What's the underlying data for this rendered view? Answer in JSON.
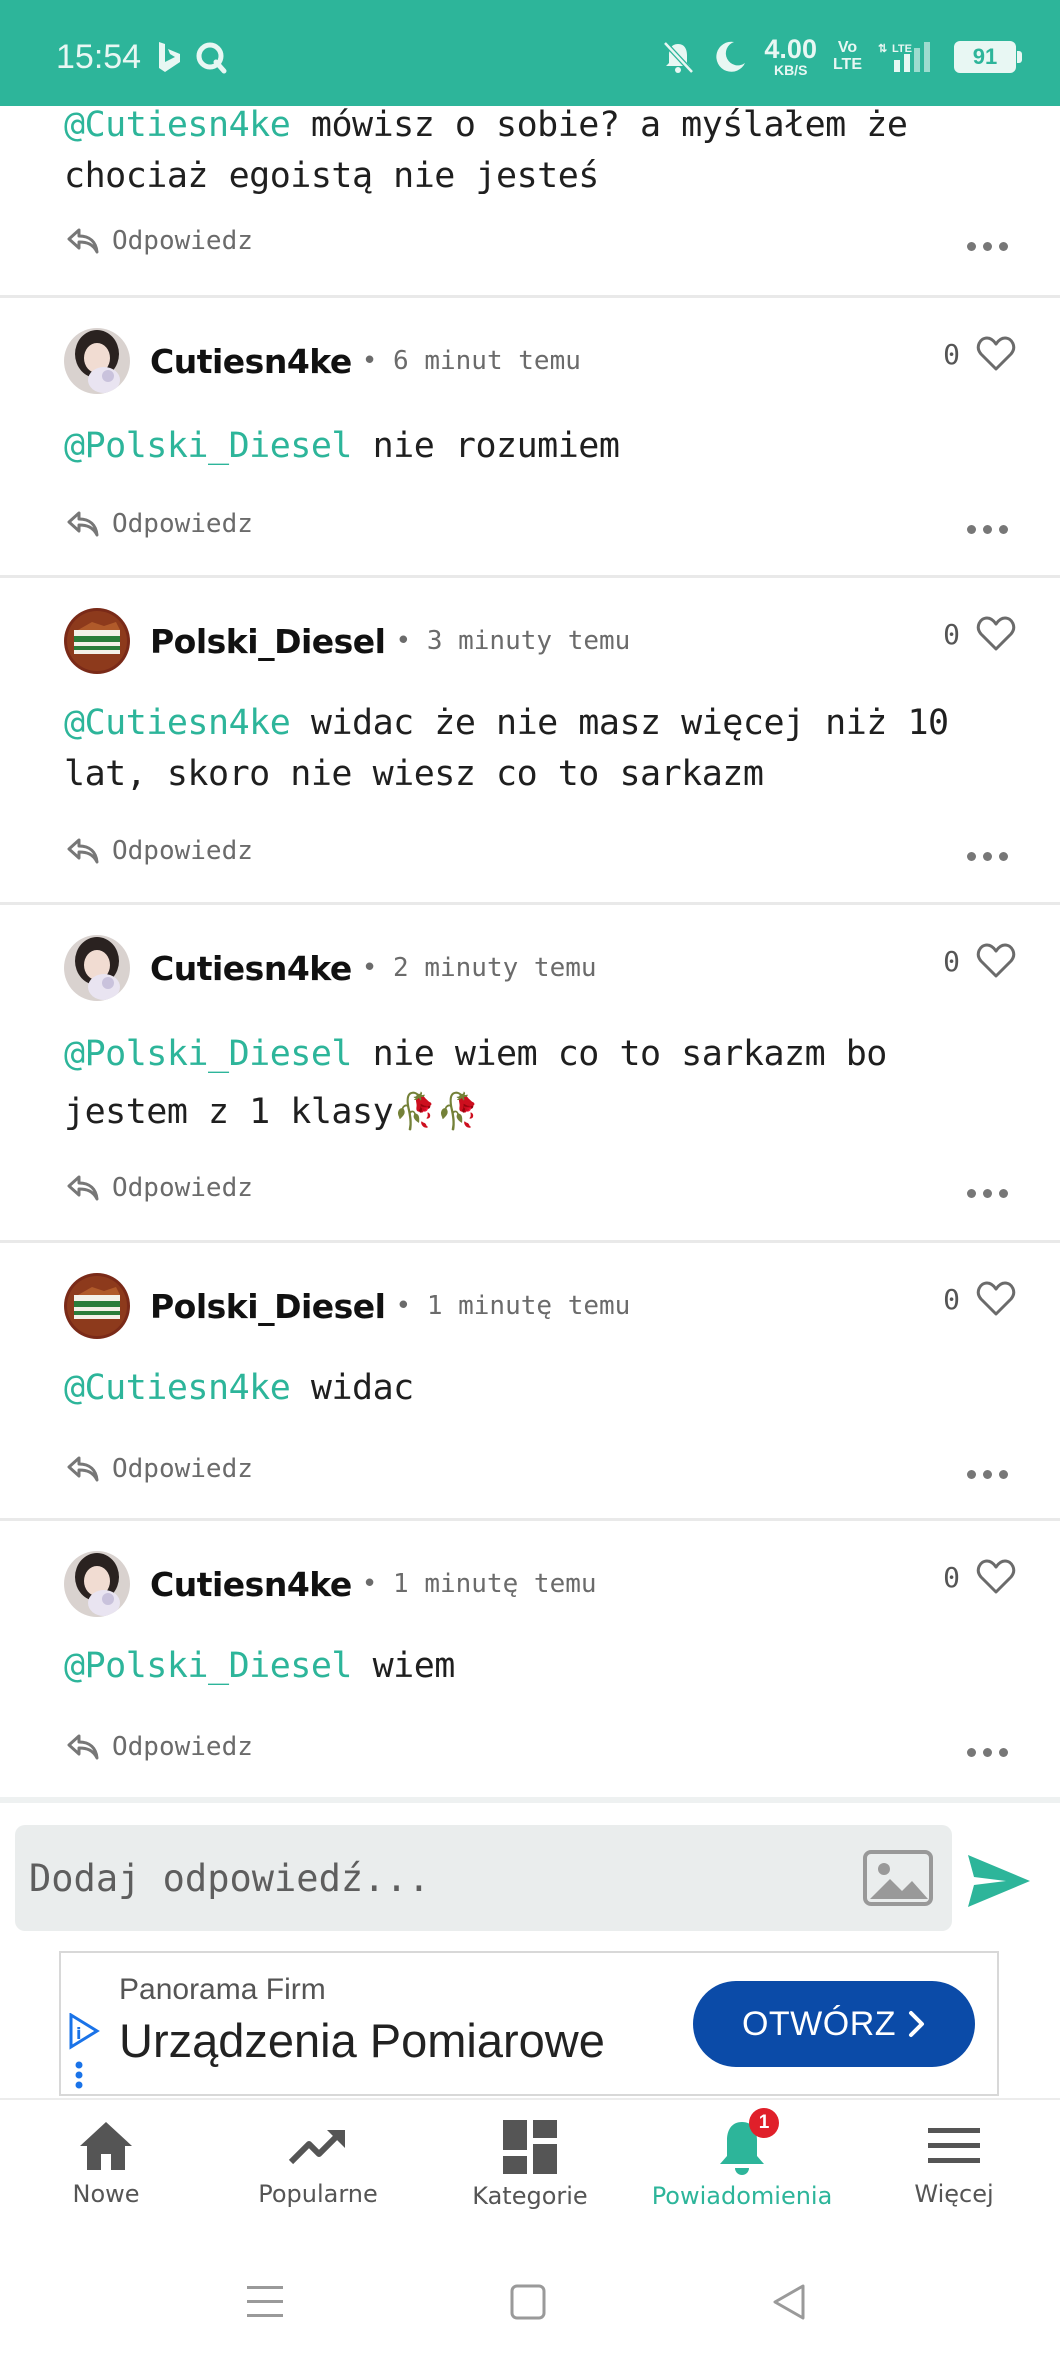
{
  "status_bar": {
    "time": "15:54",
    "net_speed": "4.00",
    "net_unit": "KB/S",
    "volte_top": "Vo",
    "volte_bottom": "LTE",
    "lte": "LTE",
    "battery": "91",
    "color": "#2db59a"
  },
  "comments": [
    {
      "mention": "@Cutiesn4ke",
      "text": " mówisz o sobie? a myślałem że chociaż egoistą nie jesteś",
      "reply_label": "Odpowiedz",
      "partial": true
    },
    {
      "username": "Cutiesn4ke",
      "time": "6 minut temu",
      "likes": "0",
      "avatar": "girl-avatar",
      "mention": "@Polski_Diesel",
      "text": " nie rozumiem",
      "reply_label": "Odpowiedz"
    },
    {
      "username": "Polski_Diesel",
      "time": "3 minuty temu",
      "likes": "0",
      "avatar": "flag-avatar",
      "mention": "@Cutiesn4ke",
      "text": " widac że nie masz więcej niż 10 lat, skoro nie wiesz co to sarkazm",
      "reply_label": "Odpowiedz"
    },
    {
      "username": "Cutiesn4ke",
      "time": "2 minuty temu",
      "likes": "0",
      "avatar": "girl-avatar",
      "mention": "@Polski_Diesel",
      "text": " nie wiem co to sarkazm bo jestem z 1 klasy🥀🥀",
      "reply_label": "Odpowiedz"
    },
    {
      "username": "Polski_Diesel",
      "time": "1 minutę temu",
      "likes": "0",
      "avatar": "flag-avatar",
      "mention": "@Cutiesn4ke",
      "text": " widac",
      "reply_label": "Odpowiedz"
    },
    {
      "username": "Cutiesn4ke",
      "time": "1 minutę temu",
      "likes": "0",
      "avatar": "girl-avatar",
      "mention": "@Polski_Diesel",
      "text": " wiem",
      "reply_label": "Odpowiedz"
    }
  ],
  "reply_bar": {
    "placeholder": "Dodaj odpowiedź..."
  },
  "ad": {
    "brand": "Panorama Firm",
    "title": "Urządzenia Pomiarowe",
    "cta": "OTWÓRZ",
    "cta_color": "#0b4ba8"
  },
  "bottom_nav": {
    "items": [
      {
        "label": "Nowe",
        "icon": "home-icon"
      },
      {
        "label": "Popularne",
        "icon": "trending-icon"
      },
      {
        "label": "Kategorie",
        "icon": "grid-icon"
      },
      {
        "label": "Powiadomienia",
        "icon": "bell-icon",
        "active": true,
        "badge": "1"
      },
      {
        "label": "Więcej",
        "icon": "menu-icon"
      }
    ]
  },
  "accent_color": "#2db59a"
}
